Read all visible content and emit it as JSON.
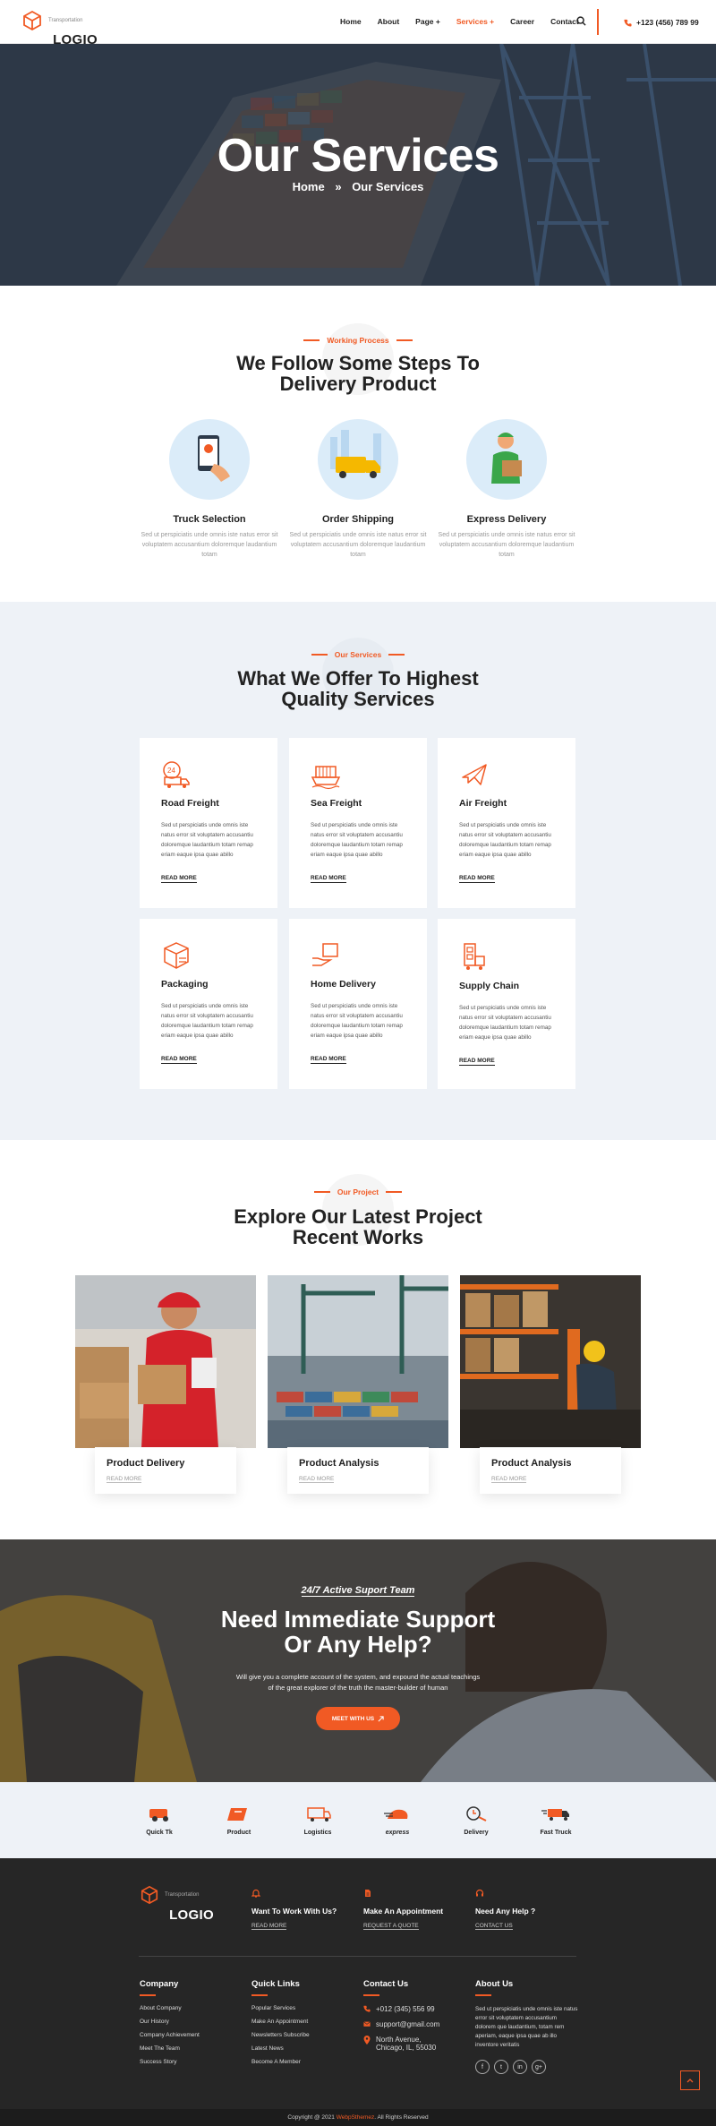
{
  "header": {
    "logo_name": "LOGIO",
    "logo_tag": "Transportation",
    "nav": [
      "Home",
      "About",
      "Page +",
      "Services +",
      "Career",
      "Contact"
    ],
    "active_nav": "Services +",
    "phone": "+123 (456) 789 99"
  },
  "hero": {
    "title": "Our Services",
    "crumb_home": "Home",
    "crumb_sep": "»",
    "crumb_current": "Our Services"
  },
  "process": {
    "subtitle": "Working Process",
    "title_line1": "We Follow Some Steps To",
    "title_line2": "Delivery Product",
    "steps": [
      {
        "title": "Truck Selection",
        "text": "Sed ut perspiciatis unde omnis iste natus error sit voluptatem accusantium doloremque laudantium totam"
      },
      {
        "title": "Order Shipping",
        "text": "Sed ut perspiciatis unde omnis iste natus error sit voluptatem accusantium doloremque laudantium totam"
      },
      {
        "title": "Express Delivery",
        "text": "Sed ut perspiciatis unde omnis iste natus error sit voluptatem accusantium doloremque laudantium totam"
      }
    ]
  },
  "services": {
    "subtitle": "Our Services",
    "title_line1": "What We Offer To Highest",
    "title_line2": "Quality Services",
    "read_more": "READ MORE",
    "items": [
      {
        "title": "Road Freight",
        "icon": "truck-icon",
        "text": "Sed ut perspiciatis unde omnis iste natus error sit voluptatem accusantiu doloremque laudantium totam remap eriam eaque ipsa quae abillo"
      },
      {
        "title": "Sea Freight",
        "icon": "ship-icon",
        "text": "Sed ut perspiciatis unde omnis iste natus error sit voluptatem accusantiu doloremque laudantium totam remap eriam eaque ipsa quae abillo"
      },
      {
        "title": "Air Freight",
        "icon": "plane-icon",
        "text": "Sed ut perspiciatis unde omnis iste natus error sit voluptatem accusantiu doloremque laudantium totam remap eriam eaque ipsa quae abillo"
      },
      {
        "title": "Packaging",
        "icon": "package-icon",
        "text": "Sed ut perspiciatis unde omnis iste natus error sit voluptatem accusantiu doloremque laudantium totam remap eriam eaque ipsa quae abillo"
      },
      {
        "title": "Home Delivery",
        "icon": "home-delivery-icon",
        "text": "Sed ut perspiciatis unde omnis iste natus error sit voluptatem accusantiu doloremque laudantium totam remap eriam eaque ipsa quae abillo"
      },
      {
        "title": "Supply Chain",
        "icon": "supply-chain-icon",
        "text": "Sed ut perspiciatis unde omnis iste natus error sit voluptatem accusantiu doloremque laudantium totam remap eriam eaque ipsa quae abillo"
      }
    ]
  },
  "projects": {
    "subtitle": "Our Project",
    "title_line1": "Explore Our Latest Project",
    "title_line2": "Recent Works",
    "read_more": "READ MORE",
    "items": [
      {
        "title": "Product Delivery"
      },
      {
        "title": "Product Analysis"
      },
      {
        "title": "Product Analysis"
      }
    ]
  },
  "support": {
    "tagline": "24/7 Active Suport Team",
    "title_line1": "Need Immediate Support",
    "title_line2": "Or Any Help?",
    "text_line1": "Will give you a complete account of the system, and expound the actual teachings",
    "text_line2": "of the great explorer of the truth the master-builder of human",
    "button": "MEET WITH US"
  },
  "brands": [
    "Quick Tk",
    "Product",
    "Logistics",
    "express",
    "Delivery",
    "Fast Truck"
  ],
  "footer": {
    "ctas": [
      {
        "title": "Want To Work With Us?",
        "link": "READ MORE"
      },
      {
        "title": "Make An Appointment",
        "link": "REQUEST A QUOTE"
      },
      {
        "title": "Need Any Help ?",
        "link": "CONTACT US"
      }
    ],
    "company_title": "Company",
    "company_links": [
      "About Company",
      "Our History",
      "Company Achievement",
      "Meet The Team",
      "Success Story"
    ],
    "quick_title": "Quick Links",
    "quick_links": [
      "Popular Services",
      "Make An Appointment",
      "Newsletters Subscribe",
      "Latest News",
      "Become A Member"
    ],
    "contact_title": "Contact Us",
    "contact_phone": "+012 (345) 556 99",
    "contact_email": "support@gmail.com",
    "contact_addr1": "North Avenue,",
    "contact_addr2": "Chicago, IL, 55030",
    "about_title": "About Us",
    "about_text": "Sed ut perspiciatis unde omnis iste natus error sit voluptatem accusantium dolorem que laudantium, totam rem aperiam, eaque ipsa quae ab illo inventore veritatis",
    "social": [
      "f",
      "t",
      "in",
      "g+"
    ]
  },
  "copyright": {
    "pre": "Copyright @ 2021",
    "brand": "WebpSthemez",
    "post": ". All Rights Reserved"
  },
  "colors": {
    "accent": "#f15a24",
    "dark": "#262626",
    "light_bg": "#eef2f7"
  }
}
